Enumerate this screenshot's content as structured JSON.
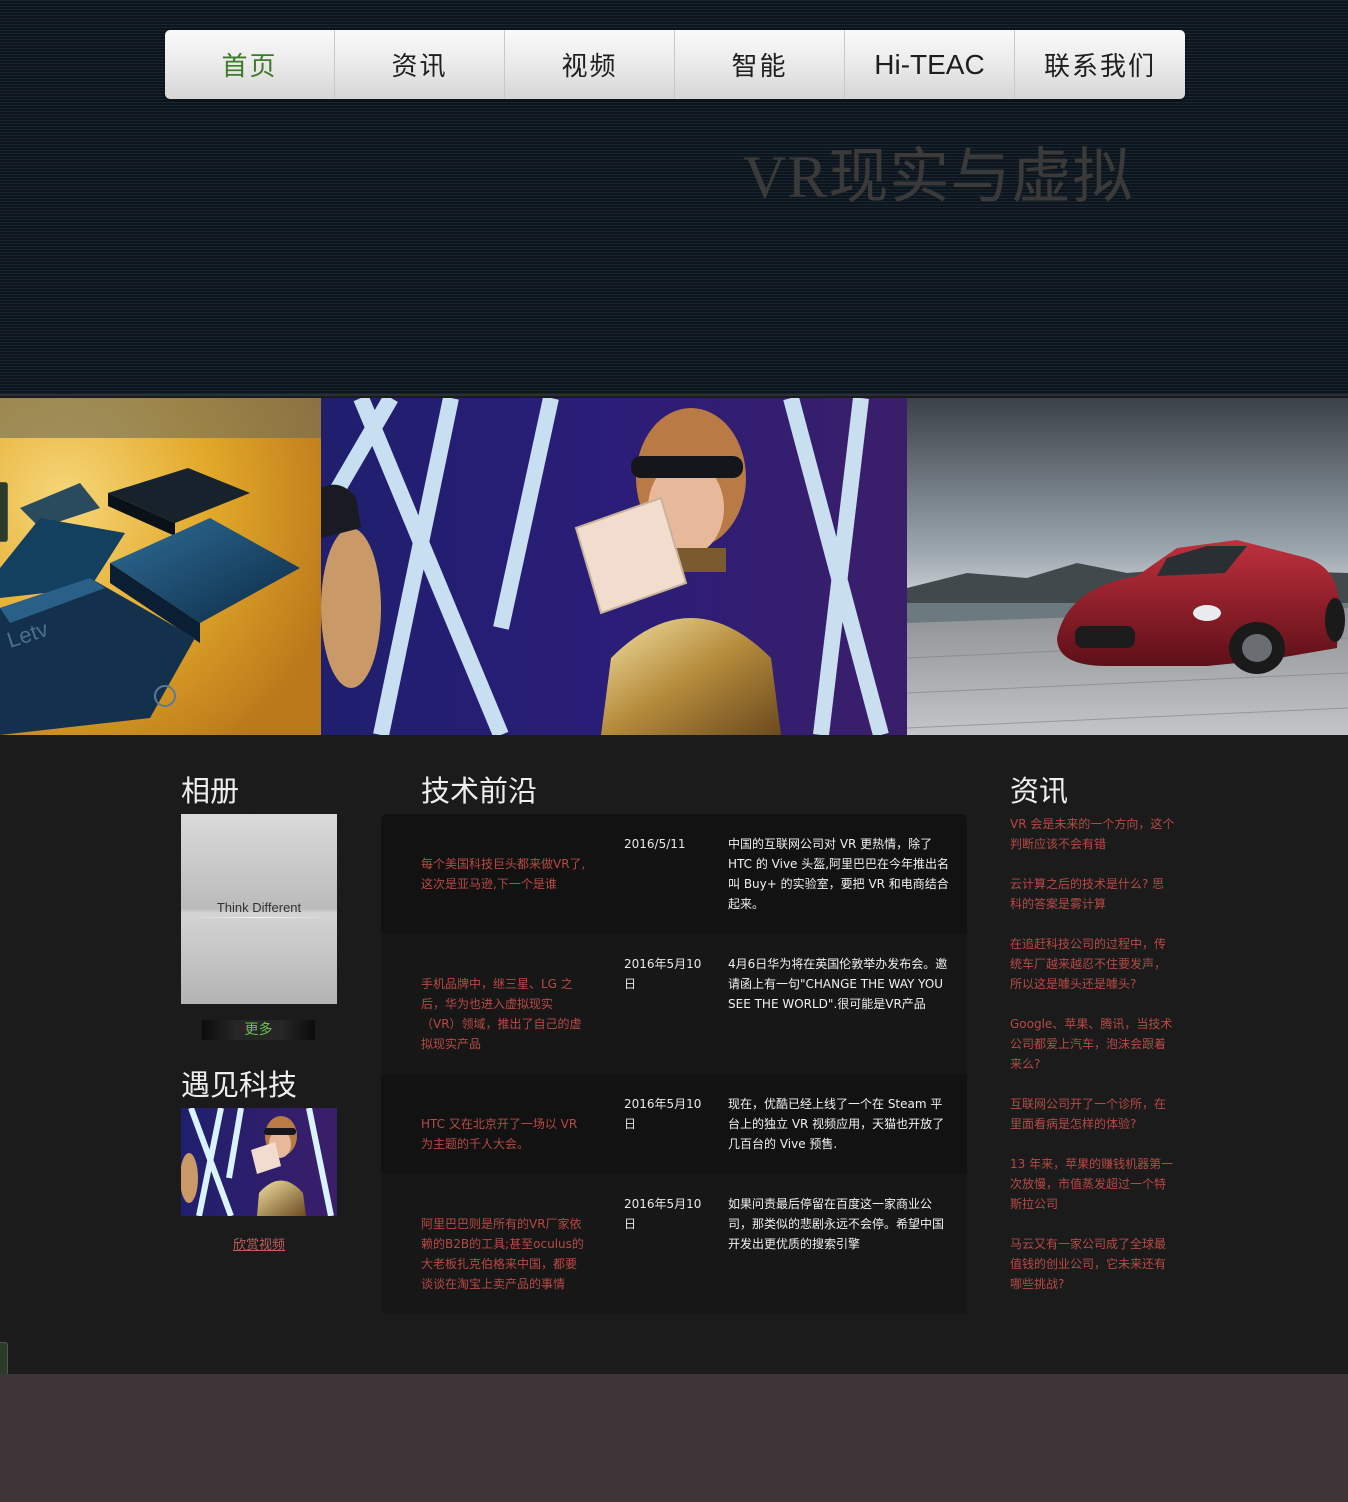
{
  "nav": {
    "items": [
      {
        "label": "首页"
      },
      {
        "label": "资讯"
      },
      {
        "label": "视频"
      },
      {
        "label": "智能"
      },
      {
        "label": "Hi-TEAC"
      },
      {
        "label": "联系我们"
      }
    ],
    "active_color": "#3d7a2a"
  },
  "hero": {
    "title": "VR现实与虚拟"
  },
  "album": {
    "title": "相册",
    "image_text": "Think Different",
    "more_label": "更多"
  },
  "meet": {
    "title": "遇见科技",
    "video_link": "欣赏视频"
  },
  "tech": {
    "title": "技术前沿",
    "rows": [
      {
        "title": "每个美国科技巨头都来做VR了,这次是亚马逊,下一个是谁",
        "date": "2016/5/11",
        "desc": "中国的互联网公司对 VR 更热情，除了 HTC 的 Vive 头盔,阿里巴巴在今年推出名叫 Buy+ 的实验室，要把 VR 和电商结合起来。"
      },
      {
        "title": "手机品牌中，继三星、LG 之后，华为也进入虚拟现实（VR）领域，推出了自己的虚拟现实产品",
        "date": "2016年5月10日",
        "desc": "4月6日华为将在英国伦敦举办发布会。邀请函上有一句\"CHANGE THE WAY YOU SEE THE WORLD\".很可能是VR产品"
      },
      {
        "title": "HTC 又在北京开了一场以 VR 为主题的千人大会。",
        "date": "2016年5月10日",
        "desc": "现在，优酷已经上线了一个在 Steam 平台上的独立 VR 视频应用，天猫也开放了几百台的 Vive 预售."
      },
      {
        "title": "阿里巴巴则是所有的VR厂家依赖的B2B的工具;甚至oculus的大老板扎克伯格来中国，都要谈谈在淘宝上卖产品的事情",
        "date": "2016年5月10日",
        "desc": "如果问责最后停留在百度这一家商业公司，那类似的悲剧永远不会停。希望中国开发出更优质的搜索引擎"
      }
    ]
  },
  "news": {
    "title": "资讯",
    "items": [
      "VR 会是未来的一个方向，这个判断应该不会有错",
      "云计算之后的技术是什么? 思科的答案是雾计算",
      "在追赶科技公司的过程中，传统车厂越来越忍不住要发声，所以这是噱头还是噱头?",
      "Google、苹果、腾讯，当技术公司都爱上汽车，泡沫会跟着来么?",
      "互联网公司开了一个诊所，在里面看病是怎样的体验?",
      "13 年来，苹果的赚钱机器第一次放慢，市值蒸发超过一个特斯拉公司",
      "马云又有一家公司成了全球最值钱的创业公司，它未来还有哪些挑战?"
    ]
  }
}
